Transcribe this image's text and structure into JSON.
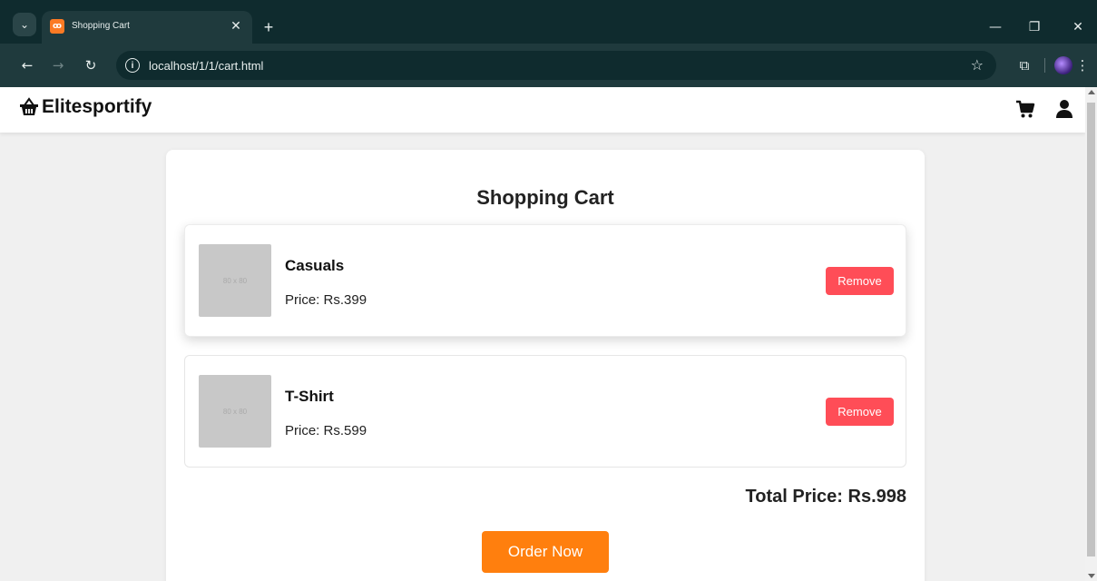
{
  "browser": {
    "tab_title": "Shopping Cart",
    "tab_favicon": "xampp-icon",
    "url": "localhost/1/1/cart.html"
  },
  "site": {
    "logo_text": "Elitesportify",
    "logo_icon": "shopping-basket-icon",
    "header_icons": [
      "cart-icon",
      "user-icon"
    ]
  },
  "cart": {
    "title": "Shopping Cart",
    "items": [
      {
        "name": "Casuals",
        "price": "Price: Rs.399",
        "thumb_text": "80 x 80",
        "remove_label": "Remove"
      },
      {
        "name": "T-Shirt",
        "price": "Price: Rs.599",
        "thumb_text": "80 x 80",
        "remove_label": "Remove"
      }
    ],
    "total": "Total Price: Rs.998",
    "order_label": "Order Now"
  },
  "colors": {
    "chrome_dark": "#0f2b2e",
    "chrome_toolbar": "#1f3a3d",
    "remove_button": "#ff4d57",
    "order_button": "#ff7f0e",
    "page_bg": "#f0f0f0"
  }
}
